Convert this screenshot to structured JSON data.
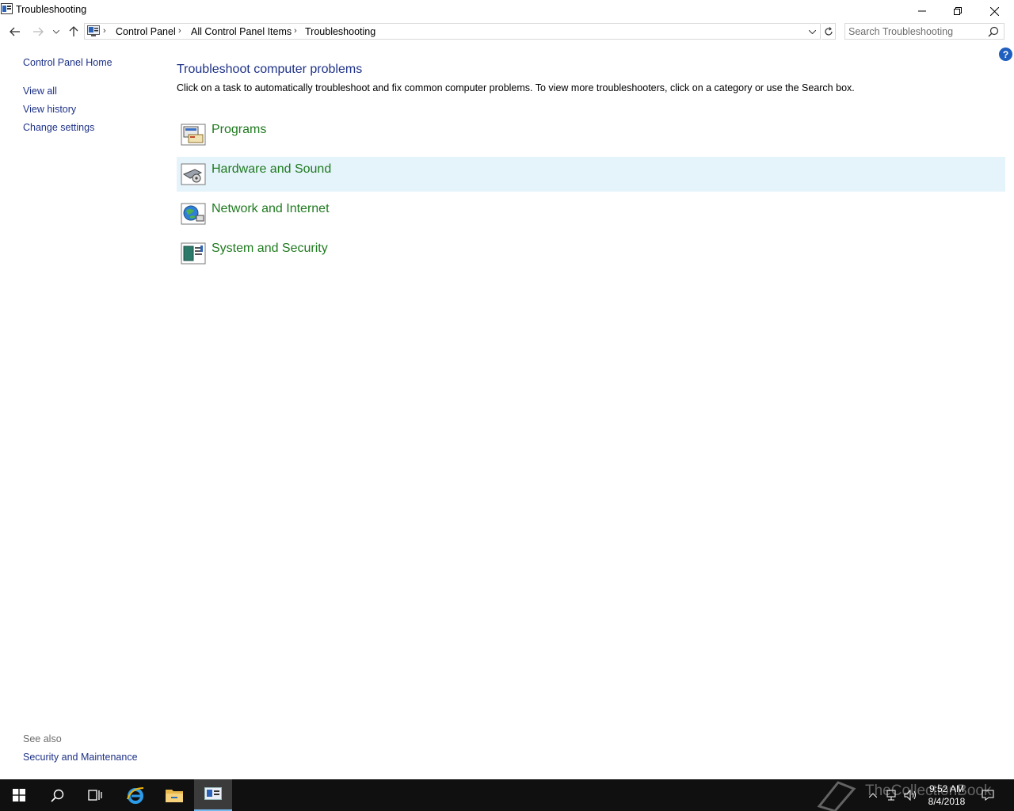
{
  "window": {
    "title": "Troubleshooting"
  },
  "address": {
    "crumbs": [
      "Control Panel",
      "All Control Panel Items",
      "Troubleshooting"
    ]
  },
  "search": {
    "placeholder": "Search Troubleshooting"
  },
  "sidebar": {
    "home": "Control Panel Home",
    "links": [
      "View all",
      "View history",
      "Change settings"
    ],
    "see_also_label": "See also",
    "see_also_links": [
      "Security and Maintenance"
    ]
  },
  "main": {
    "help_glyph": "?",
    "title": "Troubleshoot computer problems",
    "description": "Click on a task to automatically troubleshoot and fix common computer problems. To view more troubleshooters, click on a category or use the Search box.",
    "categories": [
      {
        "label": "Programs",
        "icon": "programs-icon"
      },
      {
        "label": "Hardware and Sound",
        "icon": "hardware-sound-icon",
        "hovered": true
      },
      {
        "label": "Network and Internet",
        "icon": "network-icon"
      },
      {
        "label": "System and Security",
        "icon": "system-security-icon"
      }
    ]
  },
  "taskbar": {
    "time": "9:52 AM",
    "date": "8/4/2018",
    "watermark": "TheCollectionBook"
  },
  "colors": {
    "link_blue": "#1e3287",
    "category_green": "#1f7a1f",
    "hover_bg": "#e5f3fb",
    "taskbar_bg": "#101010"
  }
}
